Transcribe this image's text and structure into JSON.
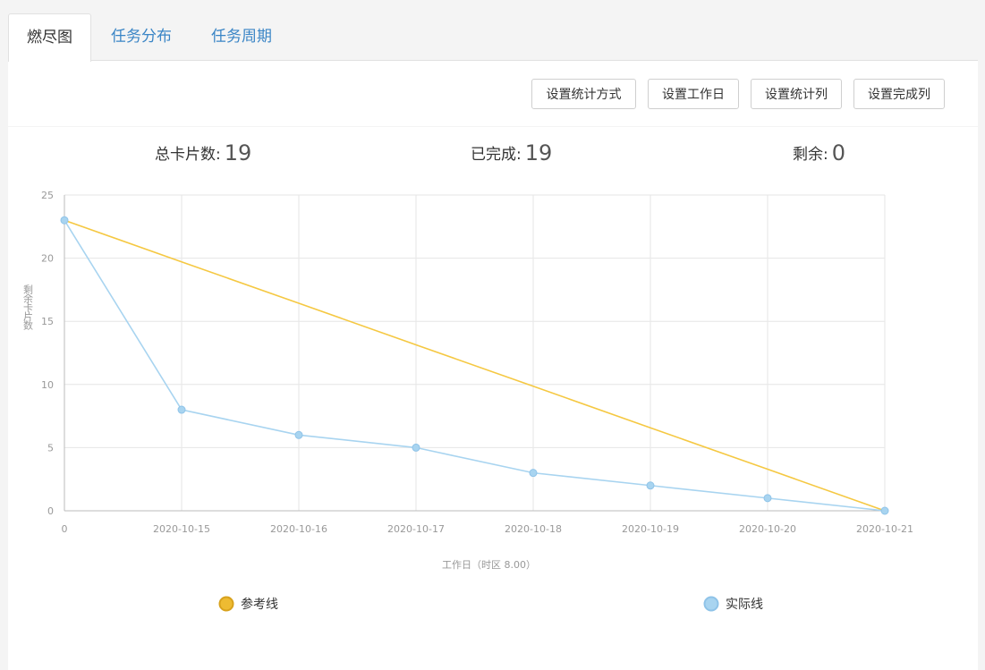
{
  "tabs": [
    {
      "label": "燃尽图",
      "active": true
    },
    {
      "label": "任务分布",
      "active": false
    },
    {
      "label": "任务周期",
      "active": false
    }
  ],
  "toolbar": {
    "buttons": [
      "设置统计方式",
      "设置工作日",
      "设置统计列",
      "设置完成列"
    ]
  },
  "stats": {
    "total_label": "总卡片数:",
    "total_value": "19",
    "done_label": "已完成:",
    "done_value": "19",
    "remaining_label": "剩余:",
    "remaining_value": "0"
  },
  "colors": {
    "reference": "#f5c842",
    "actual": "#a8d4f0",
    "tab_link": "#3a85c6"
  },
  "chart_data": {
    "type": "line",
    "x": [
      "0",
      "2020-10-15",
      "2020-10-16",
      "2020-10-17",
      "2020-10-18",
      "2020-10-19",
      "2020-10-20",
      "2020-10-21"
    ],
    "series": [
      {
        "name": "参考线",
        "values": [
          23,
          19.71,
          16.43,
          13.14,
          9.86,
          6.57,
          3.29,
          0
        ],
        "markers": false
      },
      {
        "name": "实际线",
        "values": [
          23,
          8,
          6,
          5,
          3,
          2,
          1,
          0
        ],
        "markers": true
      }
    ],
    "ylabel": "剩余卡片数",
    "xlabel": "工作日（时区 8.00）",
    "ylim": [
      0,
      25
    ],
    "yticks": [
      0,
      5,
      10,
      15,
      20,
      25
    ],
    "grid": true,
    "legend": "bottom"
  }
}
